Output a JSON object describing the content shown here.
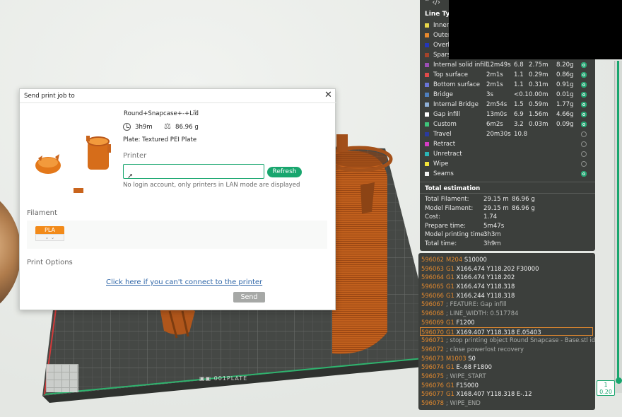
{
  "dialog": {
    "title": "Send print job to",
    "model_name": "Round+Snapcase+-+Lid",
    "print_time": "3h9m",
    "weight": "86.96 g",
    "plate": "Plate: Textured PEI Plate",
    "printer_label": "Printer",
    "printer_value": "",
    "refresh_label": "Refresh",
    "lan_note": "No login account, only printers in LAN mode are displayed",
    "filament_label": "Filament",
    "filament_chip": "PLA",
    "print_options_label": "Print Options",
    "cant_connect_link": "Click here if you can't connect to the printer",
    "send_label": "Send"
  },
  "legend": {
    "top_icons": "⌃ ‹/›",
    "header": "Line Typ",
    "rows": [
      {
        "name": "Inner",
        "time": "",
        "pct": "",
        "len": "",
        "weight": "",
        "color": "#e8d64a",
        "visible": true
      },
      {
        "name": "Outer",
        "time": "",
        "pct": "",
        "len": "",
        "weight": "",
        "color": "#e8892e",
        "visible": true
      },
      {
        "name": "Overh",
        "time": "",
        "pct": "",
        "len": "",
        "weight": "",
        "color": "#2436b8",
        "visible": true
      },
      {
        "name": "Spars",
        "time": "",
        "pct": "",
        "len": "",
        "weight": "",
        "color": "#a3432b",
        "visible": true
      },
      {
        "name": "Internal solid infill",
        "time": "12m49s",
        "pct": "6.8",
        "len": "2.75m",
        "weight": "8.20g",
        "color": "#9b4fb5",
        "visible": true
      },
      {
        "name": "Top surface",
        "time": "2m1s",
        "pct": "1.1",
        "len": "0.29m",
        "weight": "0.86g",
        "color": "#e04b4b",
        "visible": true
      },
      {
        "name": "Bottom surface",
        "time": "2m1s",
        "pct": "1.1",
        "len": "0.31m",
        "weight": "0.91g",
        "color": "#6a75d6",
        "visible": true
      },
      {
        "name": "Bridge",
        "time": "3s",
        "pct": "<0.1",
        "len": "0.00m",
        "weight": "0.01g",
        "color": "#4f7fbd",
        "visible": true
      },
      {
        "name": "Internal Bridge",
        "time": "2m54s",
        "pct": "1.5",
        "len": "0.59m",
        "weight": "1.77g",
        "color": "#8fb0d6",
        "visible": true
      },
      {
        "name": "Gap infill",
        "time": "13m0s",
        "pct": "6.9",
        "len": "1.56m",
        "weight": "4.66g",
        "color": "#ffffff",
        "visible": true
      },
      {
        "name": "Custom",
        "time": "6m2s",
        "pct": "3.2",
        "len": "0.03m",
        "weight": "0.09g",
        "color": "#3ec47a",
        "visible": true
      },
      {
        "name": "Travel",
        "time": "20m30s",
        "pct": "10.8",
        "len": "",
        "weight": "",
        "color": "#2a3a9e",
        "visible": false
      },
      {
        "name": "Retract",
        "time": "",
        "pct": "",
        "len": "",
        "weight": "",
        "color": "#d43cc4",
        "visible": false
      },
      {
        "name": "Unretract",
        "time": "",
        "pct": "",
        "len": "",
        "weight": "",
        "color": "#2bb5b5",
        "visible": false
      },
      {
        "name": "Wipe",
        "time": "",
        "pct": "",
        "len": "",
        "weight": "",
        "color": "#f2e33a",
        "visible": false
      },
      {
        "name": "Seams",
        "time": "",
        "pct": "",
        "len": "",
        "weight": "",
        "color": "#f2f2f2",
        "visible": true
      }
    ],
    "total_header": "Total estimation",
    "totals": [
      {
        "key": "Total Filament:",
        "v1": "29.15 m",
        "v2": "86.96 g"
      },
      {
        "key": "Model Filament:",
        "v1": "29.15 m",
        "v2": "86.96 g"
      },
      {
        "key": "Cost:",
        "v1": "1.74",
        "v2": ""
      },
      {
        "key": "Prepare time:",
        "v1": "5m47s",
        "v2": ""
      },
      {
        "key": "Model printing time:",
        "v1": "3h3m",
        "v2": ""
      },
      {
        "key": "Total time:",
        "v1": "3h9m",
        "v2": ""
      }
    ]
  },
  "gcode": {
    "lines": [
      {
        "n": "596062",
        "cmd": "M204",
        "arg": " S10000",
        "cmt": "",
        "hl": false
      },
      {
        "n": "596063",
        "cmd": "G1",
        "arg": " X166.474 Y118.202 F30000",
        "cmt": "",
        "hl": false
      },
      {
        "n": "596064",
        "cmd": "G1",
        "arg": " X166.474 Y118.202",
        "cmt": "",
        "hl": false
      },
      {
        "n": "596065",
        "cmd": "G1",
        "arg": " X166.474 Y118.318",
        "cmt": "",
        "hl": false
      },
      {
        "n": "596066",
        "cmd": "G1",
        "arg": " X166.244 Y118.318",
        "cmt": "",
        "hl": false
      },
      {
        "n": "596067",
        "cmd": "",
        "arg": "",
        "cmt": "; FEATURE: Gap infill",
        "hl": false
      },
      {
        "n": "596068",
        "cmd": "",
        "arg": "",
        "cmt": "; LINE_WIDTH: 0.517784",
        "hl": false
      },
      {
        "n": "596069",
        "cmd": "G1",
        "arg": " F1200",
        "cmt": "",
        "hl": false
      },
      {
        "n": "596070",
        "cmd": "G1",
        "arg": " X169.407 Y118.318 E.05403",
        "cmt": "",
        "hl": true
      },
      {
        "n": "596071",
        "cmd": "",
        "arg": "",
        "cmt": "; stop printing object Round Snapcase - Base.stl id:...",
        "hl": false
      },
      {
        "n": "596072",
        "cmd": "",
        "arg": "",
        "cmt": "; close powerlost recovery",
        "hl": false
      },
      {
        "n": "596073",
        "cmd": "M1003",
        "arg": " S0",
        "cmt": "",
        "hl": false
      },
      {
        "n": "596074",
        "cmd": "G1",
        "arg": " E-.68 F1800",
        "cmt": "",
        "hl": false
      },
      {
        "n": "596075",
        "cmd": "",
        "arg": "",
        "cmt": "; WIPE_START",
        "hl": false
      },
      {
        "n": "596076",
        "cmd": "G1",
        "arg": " F15000",
        "cmt": "",
        "hl": false
      },
      {
        "n": "596077",
        "cmd": "G1",
        "arg": " X168.407 Y118.318 E-.12",
        "cmt": "",
        "hl": false
      },
      {
        "n": "596078",
        "cmd": "",
        "arg": "",
        "cmt": "; WIPE_END",
        "hl": false
      }
    ]
  },
  "layer": {
    "top": "1",
    "bottom": "0.20"
  },
  "colors": {
    "accent": "#18a66e",
    "filament": "#f28a1a",
    "model": "#c9641c"
  }
}
